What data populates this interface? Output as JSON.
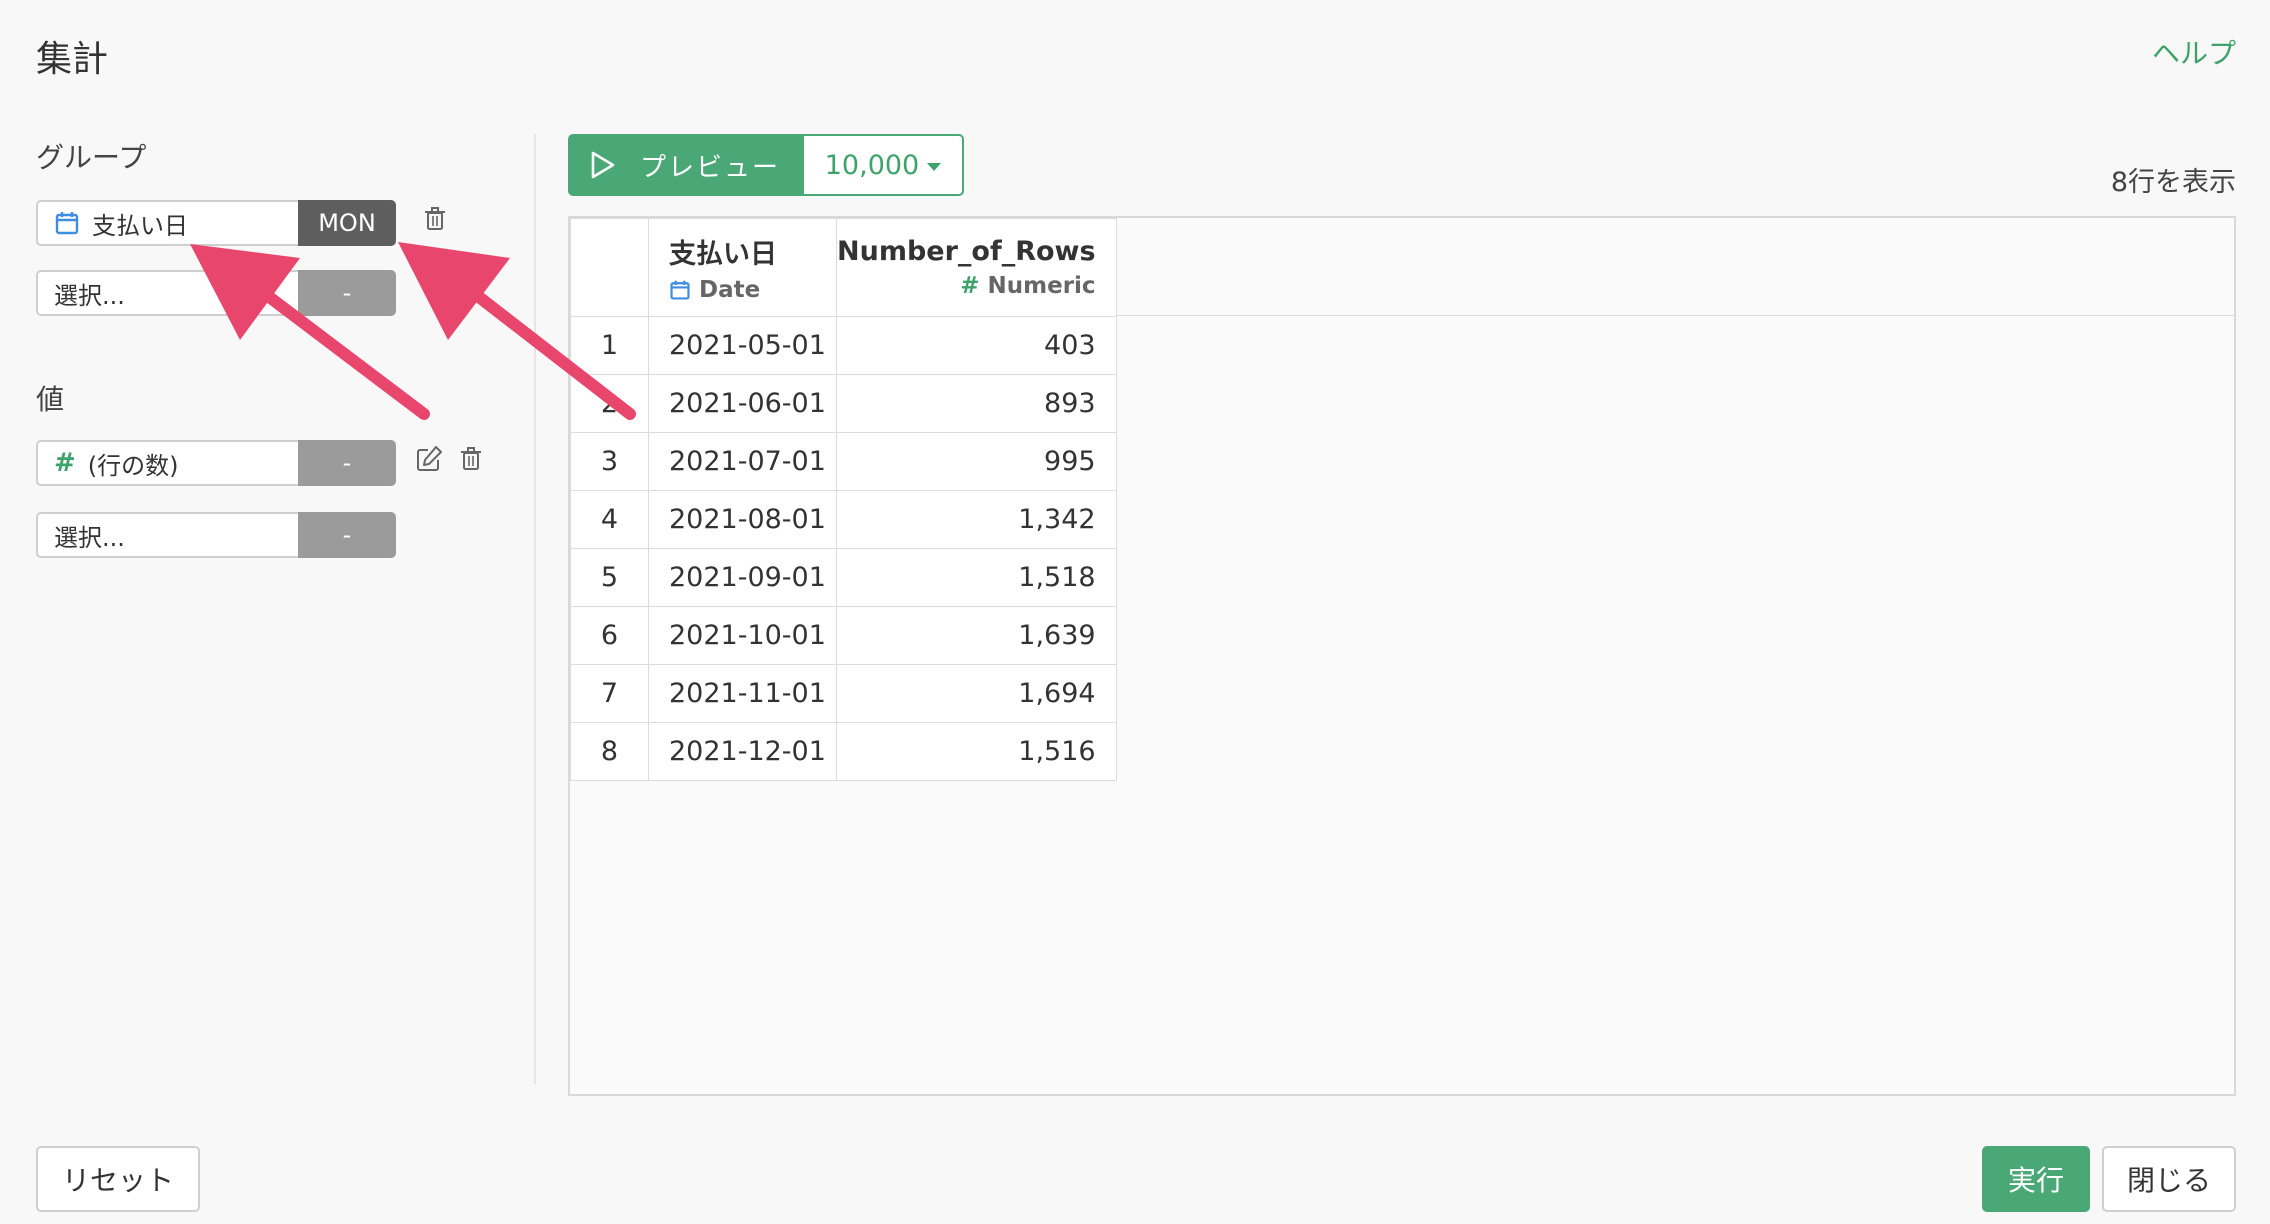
{
  "dialog": {
    "title": "集計",
    "help": "ヘルプ"
  },
  "group": {
    "label": "グループ",
    "fields": [
      {
        "text": "支払い日",
        "btn": "MON"
      },
      {
        "text": "選択...",
        "btn": "-"
      }
    ]
  },
  "values": {
    "label": "値",
    "fields": [
      {
        "text": "(行の数)",
        "btn": "-"
      },
      {
        "text": "選択...",
        "btn": "-"
      }
    ]
  },
  "toolbar": {
    "preview_label": "プレビュー",
    "rows_value": "10,000"
  },
  "row_count": "8行を表示",
  "table": {
    "columns": [
      {
        "name": "支払い日",
        "type": "Date"
      },
      {
        "name": "Number_of_Rows",
        "type": "Numeric"
      }
    ],
    "rows": [
      {
        "idx": "1",
        "date": "2021-05-01",
        "count": "403"
      },
      {
        "idx": "2",
        "date": "2021-06-01",
        "count": "893"
      },
      {
        "idx": "3",
        "date": "2021-07-01",
        "count": "995"
      },
      {
        "idx": "4",
        "date": "2021-08-01",
        "count": "1,342"
      },
      {
        "idx": "5",
        "date": "2021-09-01",
        "count": "1,518"
      },
      {
        "idx": "6",
        "date": "2021-10-01",
        "count": "1,639"
      },
      {
        "idx": "7",
        "date": "2021-11-01",
        "count": "1,694"
      },
      {
        "idx": "8",
        "date": "2021-12-01",
        "count": "1,516"
      }
    ]
  },
  "footer": {
    "reset": "リセット",
    "run": "実行",
    "close": "閉じる"
  },
  "colors": {
    "accent": "#4aa877",
    "annotation_arrow": "#e8466c",
    "date_icon": "#3d8ee0"
  },
  "icons": {
    "date": "calendar-icon",
    "numeric": "hash-icon",
    "delete": "trash-icon",
    "edit": "edit-icon",
    "preview": "play-icon",
    "dropdown": "caret-down-icon"
  }
}
